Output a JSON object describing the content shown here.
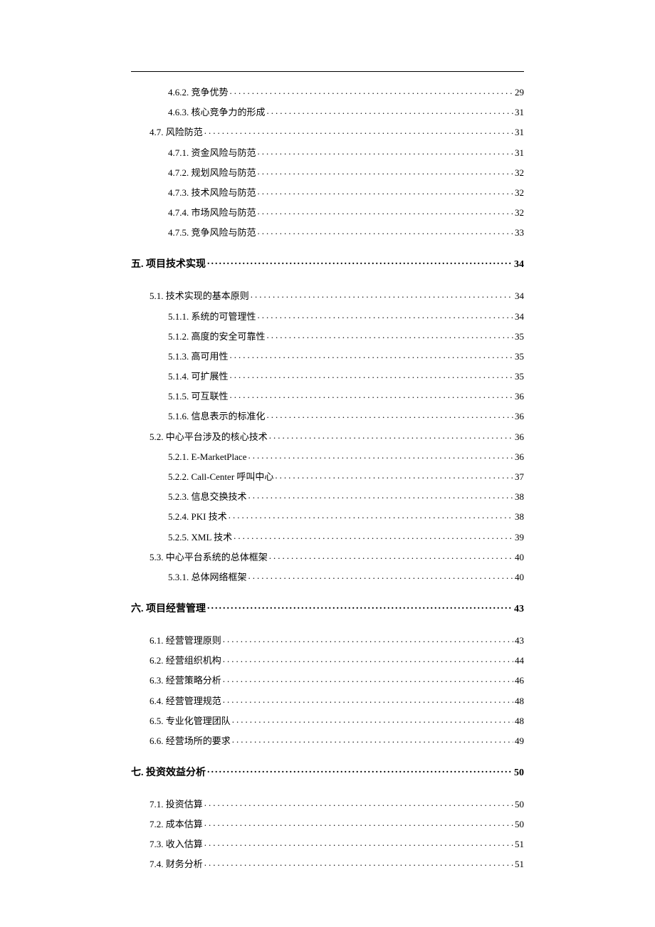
{
  "toc": [
    {
      "level": 3,
      "title": "4.6.2. 竞争优势",
      "page": "29"
    },
    {
      "level": 3,
      "title": "4.6.3. 核心竞争力的形成",
      "page": "31"
    },
    {
      "level": 2,
      "title": "4.7. 风险防范",
      "page": "31"
    },
    {
      "level": 3,
      "title": "4.7.1. 资金风险与防范",
      "page": "31"
    },
    {
      "level": 3,
      "title": "4.7.2. 规划风险与防范",
      "page": "32"
    },
    {
      "level": 3,
      "title": "4.7.3. 技术风险与防范",
      "page": "32"
    },
    {
      "level": 3,
      "title": "4.7.4. 市场风险与防范",
      "page": "32"
    },
    {
      "level": 3,
      "title": "4.7.5. 竞争风险与防范",
      "page": "33"
    },
    {
      "level": 1,
      "title": "五. 项目技术实现",
      "page": "34"
    },
    {
      "level": 2,
      "title": "5.1. 技术实现的基本原则",
      "page": "34"
    },
    {
      "level": 3,
      "title": "5.1.1. 系统的可管理性",
      "page": "34"
    },
    {
      "level": 3,
      "title": "5.1.2. 高度的安全可靠性",
      "page": "35"
    },
    {
      "level": 3,
      "title": "5.1.3. 高可用性",
      "page": "35"
    },
    {
      "level": 3,
      "title": "5.1.4. 可扩展性",
      "page": "35"
    },
    {
      "level": 3,
      "title": "5.1.5. 可互联性",
      "page": "36"
    },
    {
      "level": 3,
      "title": "5.1.6. 信息表示的标准化",
      "page": "36"
    },
    {
      "level": 2,
      "title": "5.2. 中心平台涉及的核心技术",
      "page": "36"
    },
    {
      "level": 3,
      "title": "5.2.1. E-MarketPlace",
      "page": "36"
    },
    {
      "level": 3,
      "title": "5.2.2. Call-Center 呼叫中心",
      "page": "37"
    },
    {
      "level": 3,
      "title": "5.2.3. 信息交换技术",
      "page": "38"
    },
    {
      "level": 3,
      "title": "5.2.4. PKI 技术",
      "page": "38"
    },
    {
      "level": 3,
      "title": "5.2.5. XML 技术",
      "page": "39"
    },
    {
      "level": 2,
      "title": "5.3. 中心平台系统的总体框架",
      "page": "40"
    },
    {
      "level": 3,
      "title": "5.3.1. 总体网络框架",
      "page": "40"
    },
    {
      "level": 1,
      "title": "六. 项目经营管理",
      "page": "43"
    },
    {
      "level": 2,
      "title": "6.1. 经营管理原则",
      "page": "43"
    },
    {
      "level": 2,
      "title": "6.2. 经营组织机构",
      "page": "44"
    },
    {
      "level": 2,
      "title": "6.3. 经营策略分析",
      "page": "46"
    },
    {
      "level": 2,
      "title": "6.4. 经营管理规范",
      "page": "48"
    },
    {
      "level": 2,
      "title": "6.5. 专业化管理团队",
      "page": "48"
    },
    {
      "level": 2,
      "title": "6.6. 经营场所的要求",
      "page": "49"
    },
    {
      "level": 1,
      "title": "七. 投资效益分析",
      "page": "50"
    },
    {
      "level": 2,
      "title": "7.1. 投资估算",
      "page": "50"
    },
    {
      "level": 2,
      "title": "7.2. 成本估算",
      "page": "50"
    },
    {
      "level": 2,
      "title": "7.3. 收入估算",
      "page": "51"
    },
    {
      "level": 2,
      "title": "7.4. 财务分析",
      "page": "51"
    }
  ]
}
